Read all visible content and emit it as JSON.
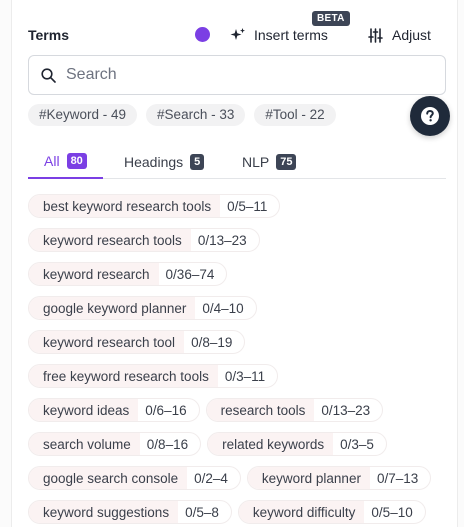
{
  "header": {
    "title": "Terms",
    "insert_label": "Insert terms",
    "beta_label": "BETA",
    "adjust_label": "Adjust"
  },
  "search": {
    "placeholder": "Search"
  },
  "tags": [
    "#Keyword - 49",
    "#Search - 33",
    "#Tool - 22"
  ],
  "tabs": [
    {
      "label": "All",
      "count": "80"
    },
    {
      "label": "Headings",
      "count": "5"
    },
    {
      "label": "NLP",
      "count": "75"
    }
  ],
  "terms": [
    [
      {
        "term": "best keyword research tools",
        "range": "0/5–11"
      }
    ],
    [
      {
        "term": "keyword research tools",
        "range": "0/13–23"
      }
    ],
    [
      {
        "term": "keyword research",
        "range": "0/36–74"
      }
    ],
    [
      {
        "term": "google keyword planner",
        "range": "0/4–10"
      }
    ],
    [
      {
        "term": "keyword research tool",
        "range": "0/8–19"
      }
    ],
    [
      {
        "term": "free keyword research tools",
        "range": "0/3–11"
      }
    ],
    [
      {
        "term": "keyword ideas",
        "range": "0/6–16"
      },
      {
        "term": "research tools",
        "range": "0/13–23"
      }
    ],
    [
      {
        "term": "search volume",
        "range": "0/8–16"
      },
      {
        "term": "related keywords",
        "range": "0/3–5"
      }
    ],
    [
      {
        "term": "google search console",
        "range": "0/2–4"
      },
      {
        "term": "keyword planner",
        "range": "0/7–13"
      }
    ],
    [
      {
        "term": "keyword suggestions",
        "range": "0/5–8"
      },
      {
        "term": "keyword difficulty",
        "range": "0/5–10"
      }
    ]
  ],
  "colors": {
    "accent": "#7b3fe4",
    "badge": "#3d4556",
    "help_button": "#1f2a3a"
  }
}
